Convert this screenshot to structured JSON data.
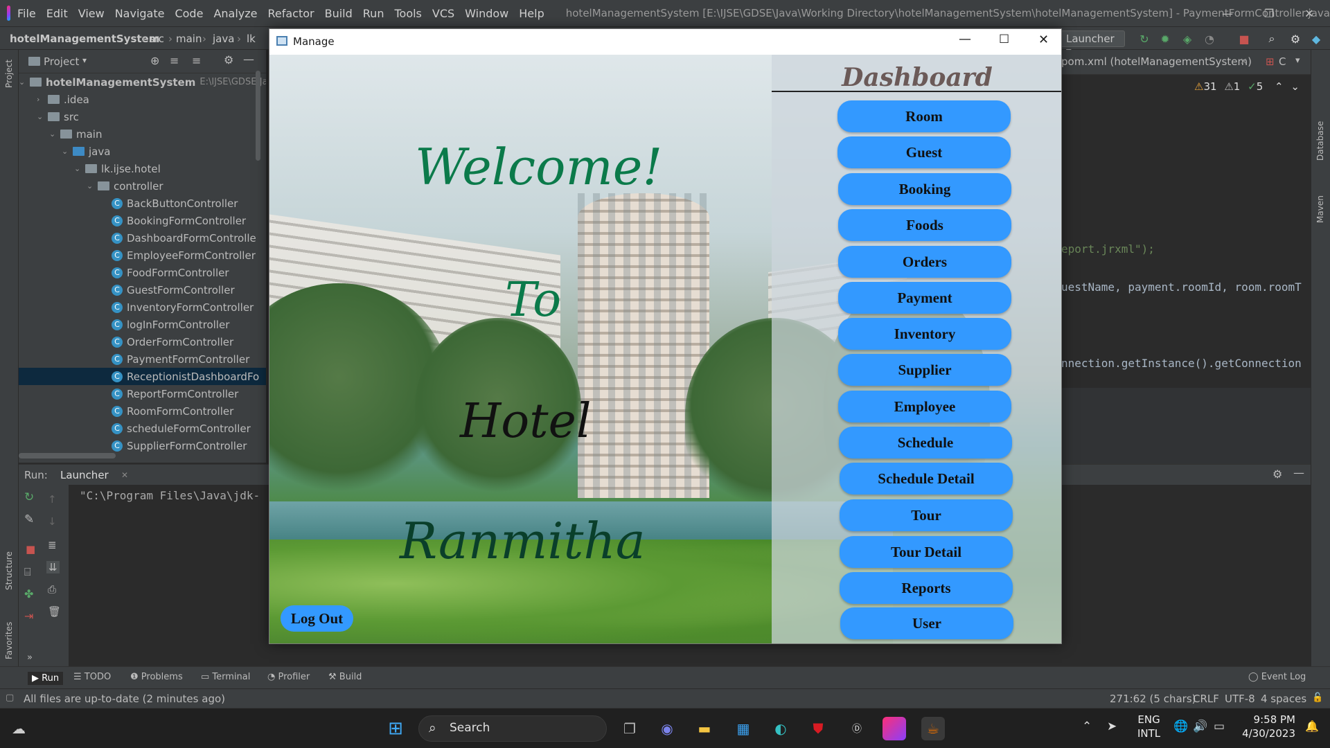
{
  "ide": {
    "menu": [
      "File",
      "Edit",
      "View",
      "Navigate",
      "Code",
      "Analyze",
      "Refactor",
      "Build",
      "Run",
      "Tools",
      "VCS",
      "Window",
      "Help"
    ],
    "window_title": "hotelManagementSystem [E:\\IJSE\\GDSE\\Java\\Working Directory\\hotelManagementSystem\\hotelManagementSystem] - PaymentFormController.java",
    "breadcrumbs": [
      "hotelManagementSystem",
      "src",
      "main",
      "java",
      "lk"
    ],
    "run_config": "Launcher",
    "project_label": "Project",
    "tree": [
      {
        "label": "hotelManagementSystem",
        "extra": "E:\\IJSE\\GDSE\\Jav",
        "type": "module"
      },
      {
        "label": ".idea",
        "type": "folder"
      },
      {
        "label": "src",
        "type": "folder"
      },
      {
        "label": "main",
        "type": "folder"
      },
      {
        "label": "java",
        "type": "folder-blue"
      },
      {
        "label": "lk.ijse.hotel",
        "type": "folder"
      },
      {
        "label": "controller",
        "type": "folder"
      },
      {
        "label": "BackButtonController",
        "type": "class"
      },
      {
        "label": "BookingFormController",
        "type": "class"
      },
      {
        "label": "DashboardFormControlle",
        "type": "class"
      },
      {
        "label": "EmployeeFormController",
        "type": "class"
      },
      {
        "label": "FoodFormController",
        "type": "class"
      },
      {
        "label": "GuestFormController",
        "type": "class"
      },
      {
        "label": "InventoryFormController",
        "type": "class"
      },
      {
        "label": "logInFormController",
        "type": "class"
      },
      {
        "label": "OrderFormController",
        "type": "class"
      },
      {
        "label": "PaymentFormController",
        "type": "class"
      },
      {
        "label": "ReceptionistDashboardFo",
        "type": "class",
        "selected": true
      },
      {
        "label": "ReportFormController",
        "type": "class"
      },
      {
        "label": "RoomFormController",
        "type": "class"
      },
      {
        "label": "scheduleFormController",
        "type": "class"
      },
      {
        "label": "SupplierFormController",
        "type": "class"
      }
    ],
    "editor_tab": "pom.xml (hotelManagementSystem)",
    "editor_tab2": "C",
    "inspections": {
      "warnings": "31",
      "weak": "1",
      "ok": "5"
    },
    "code_lines": [
      "eport.jrxml\");",
      "uestName, payment.roomId, room.roomT",
      "nnection.getInstance().getConnection"
    ],
    "run_label": "Run:",
    "run_tab": "Launcher",
    "run_output": "\"C:\\Program Files\\Java\\jdk-",
    "left_strip": [
      "Project",
      "Structure",
      "Favorites"
    ],
    "right_strip": [
      "Database",
      "Maven"
    ],
    "tool_tabs": [
      "Run",
      "TODO",
      "Problems",
      "Terminal",
      "Profiler",
      "Build"
    ],
    "event_log": "Event Log",
    "status_left": "All files are up-to-date (2 minutes ago)",
    "status_right": [
      "271:62 (5 chars)",
      "CRLF",
      "UTF-8",
      "4 spaces"
    ]
  },
  "app": {
    "window_title": "Manage",
    "welcome": [
      "Welcome!",
      "To",
      "Hotel",
      "Ranmitha"
    ],
    "dashboard_title": "Dashboard",
    "buttons": [
      "Room",
      "Guest",
      "Booking",
      "Foods",
      "Orders",
      "Payment",
      "Inventory",
      "Supplier",
      "Employee",
      "Schedule",
      "Schedule Detail",
      "Tour",
      "Tour Detail",
      "Reports",
      "User"
    ],
    "logout": "Log Out",
    "colors": {
      "button": "#3399ff",
      "welcome": "#0b7a4a",
      "dark_text": "#111111",
      "dashboard_title": "#6b5a58"
    }
  },
  "taskbar": {
    "search": "Search",
    "lang": [
      "ENG",
      "INTL"
    ],
    "time": "9:58 PM",
    "date": "4/30/2023"
  }
}
